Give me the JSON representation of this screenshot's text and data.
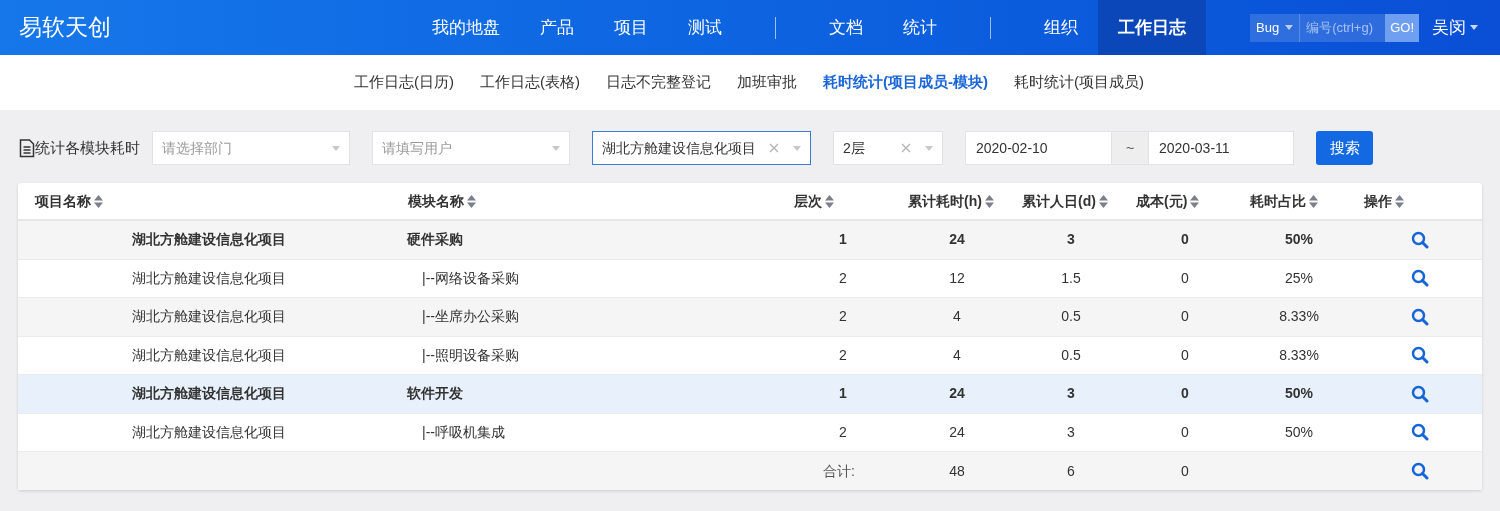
{
  "brand": "易软天创",
  "nav": [
    {
      "label": "我的地盘",
      "selected": false
    },
    {
      "label": "产品",
      "selected": false
    },
    {
      "label": "项目",
      "selected": false
    },
    {
      "label": "测试",
      "selected": false
    },
    {
      "kind": "divider"
    },
    {
      "label": "文档",
      "selected": false
    },
    {
      "label": "统计",
      "selected": false
    },
    {
      "kind": "divider"
    },
    {
      "label": "组织",
      "selected": false
    },
    {
      "label": "工作日志",
      "selected": true
    }
  ],
  "quick_search": {
    "type": "Bug",
    "placeholder": "编号(ctrl+g)",
    "button": "GO!"
  },
  "user": "吴闵",
  "subnav": [
    {
      "label": "工作日志(日历)",
      "selected": false
    },
    {
      "label": "工作日志(表格)",
      "selected": false
    },
    {
      "label": "日志不完整登记",
      "selected": false
    },
    {
      "label": "加班审批",
      "selected": false
    },
    {
      "label": "耗时统计(项目成员-模块)",
      "selected": true
    },
    {
      "label": "耗时统计(项目成员)",
      "selected": false
    }
  ],
  "filters": {
    "title": "统计各模块耗时",
    "department": {
      "placeholder": "请选择部门"
    },
    "user": {
      "placeholder": "请填写用户"
    },
    "project": {
      "value": "湖北方舱建设信息化项目"
    },
    "level": {
      "value": "2层"
    },
    "date_from": "2020-02-10",
    "date_sep": "~",
    "date_to": "2020-03-11",
    "search_button": "搜索"
  },
  "table": {
    "columns": [
      "项目名称",
      "模块名称",
      "层次",
      "累计耗时(h)",
      "累计人日(d)",
      "成本(元)",
      "耗时占比",
      "操作"
    ],
    "rows": [
      {
        "kind": "group",
        "selected": false,
        "project": "湖北方舱建设信息化项目",
        "module": "硬件采购",
        "level": "1",
        "hours": "24",
        "days": "3",
        "cost": "0",
        "ratio": "50%"
      },
      {
        "kind": "item",
        "selected": false,
        "project": "湖北方舱建设信息化项目",
        "module": "|--网络设备采购",
        "level": "2",
        "hours": "12",
        "days": "1.5",
        "cost": "0",
        "ratio": "25%"
      },
      {
        "kind": "item",
        "selected": false,
        "project": "湖北方舱建设信息化项目",
        "module": "|--坐席办公采购",
        "level": "2",
        "hours": "4",
        "days": "0.5",
        "cost": "0",
        "ratio": "8.33%"
      },
      {
        "kind": "item",
        "selected": false,
        "project": "湖北方舱建设信息化项目",
        "module": "|--照明设备采购",
        "level": "2",
        "hours": "4",
        "days": "0.5",
        "cost": "0",
        "ratio": "8.33%"
      },
      {
        "kind": "group",
        "selected": true,
        "project": "湖北方舱建设信息化项目",
        "module": "软件开发",
        "level": "1",
        "hours": "24",
        "days": "3",
        "cost": "0",
        "ratio": "50%"
      },
      {
        "kind": "item",
        "selected": false,
        "project": "湖北方舱建设信息化项目",
        "module": "|--呼吸机集成",
        "level": "2",
        "hours": "24",
        "days": "3",
        "cost": "0",
        "ratio": "50%"
      }
    ],
    "total": {
      "label": "合计:",
      "hours": "48",
      "days": "6",
      "cost": "0"
    }
  }
}
